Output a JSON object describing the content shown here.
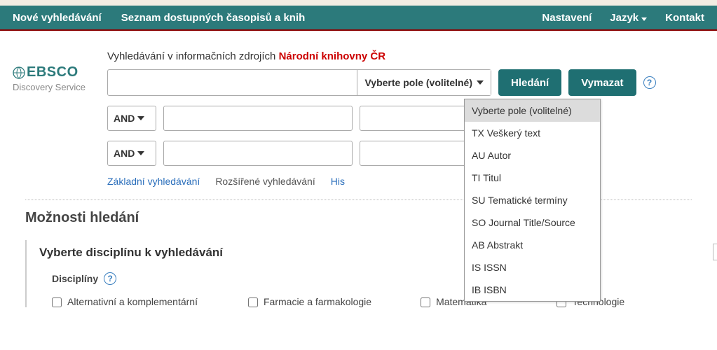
{
  "topbar": {
    "new_search": "Nové vyhledávání",
    "journals_list": "Seznam dostupných časopisů a knih",
    "settings": "Nastavení",
    "language": "Jazyk",
    "contact": "Kontakt"
  },
  "brand": {
    "name": "EBSCO",
    "subtitle": "Discovery Service"
  },
  "search": {
    "description_prefix": "Vyhledávání v informačních zdrojích ",
    "institution": "Národní knihovny ČR",
    "field_button": "Vyberte pole (volitelné)",
    "submit": "Hledání",
    "clear": "Vymazat",
    "bool_rows": [
      {
        "op": "AND"
      },
      {
        "op": "AND"
      }
    ],
    "links": {
      "basic": "Základní vyhledávání",
      "advanced": "Rozšířené vyhledávání",
      "history_prefix": "His"
    }
  },
  "dropdown_items": [
    "Vyberte pole (volitelné)",
    "TX Veškerý text",
    "AU Autor",
    "TI Titul",
    "SU Tematické termíny",
    "SO Journal Title/Source",
    "AB Abstrakt",
    "IS ISSN",
    "IB ISBN"
  ],
  "options": {
    "panel_title": "Možnosti hledání",
    "discipline_title": "Vyberte disciplínu k vyhledávání",
    "disciplines_label": "Disciplíny",
    "columns": [
      "Alternativní a komplementární",
      "Farmacie a farmakologie",
      "Matematika",
      "Technologie"
    ]
  }
}
